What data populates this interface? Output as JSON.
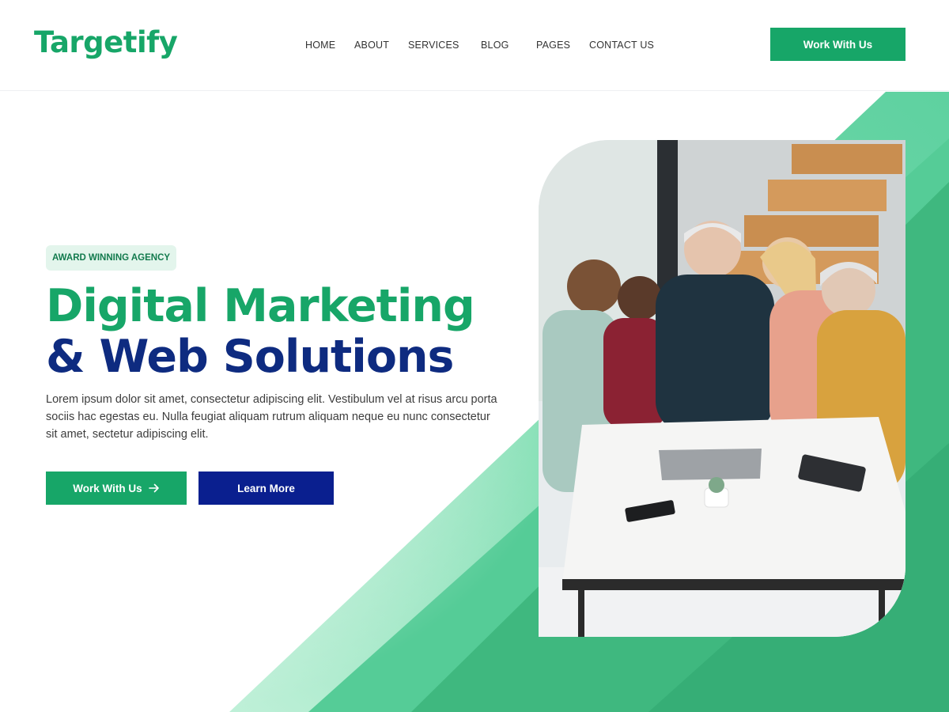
{
  "brand": {
    "logo_text": "Targetify",
    "accent": "#17a668",
    "navy": "#0e2b80",
    "button_navy": "#0a1f8f"
  },
  "nav": {
    "items": [
      {
        "label": "HOME"
      },
      {
        "label": "ABOUT"
      },
      {
        "label": "SERVICES"
      },
      {
        "label": "BLOG"
      },
      {
        "label": "PAGES"
      },
      {
        "label": "CONTACT US"
      }
    ],
    "cta_label": "Work With Us"
  },
  "hero": {
    "badge": "AWARD WINNING AGENCY",
    "headline_line1": "Digital Marketing",
    "headline_line2": "& Web Solutions",
    "description": "Lorem ipsum dolor sit amet, consectetur adipiscing elit. Vestibulum vel at risus arcu porta sociis hac egestas eu. Nulla feugiat aliquam rutrum aliquam neque eu nunc consectetur sit amet, sectetur adipiscing elit.",
    "primary_button": "Work With Us",
    "primary_button_icon": "arrow-right-icon",
    "secondary_button": "Learn More"
  }
}
